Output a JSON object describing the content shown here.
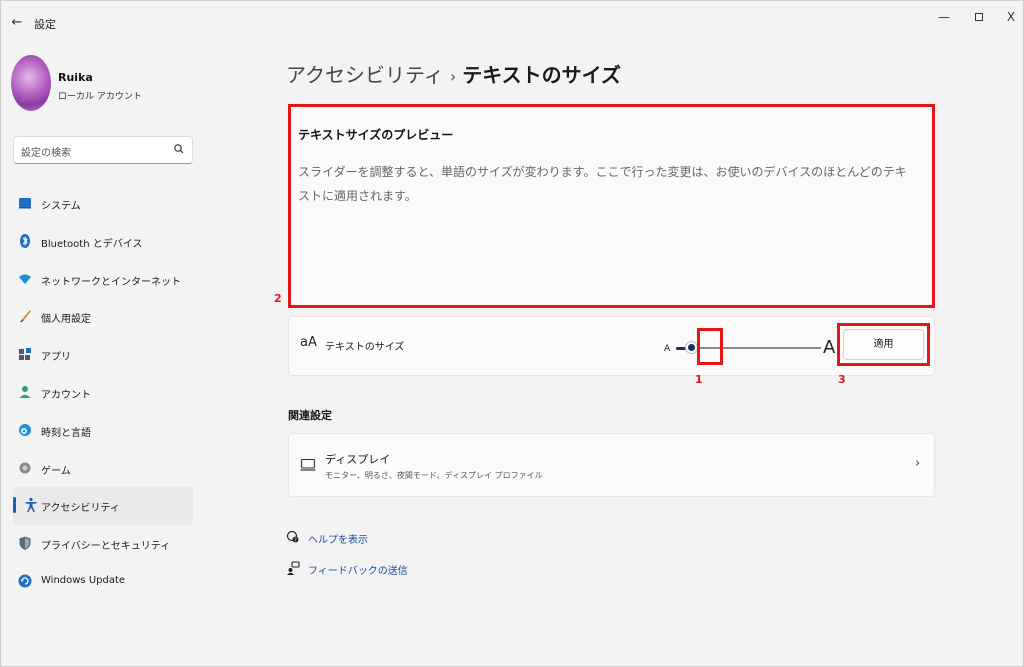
{
  "window": {
    "title": "設定",
    "back": "←",
    "minimize": "—",
    "close": "X"
  },
  "profile": {
    "name": "Ruika",
    "account_type": "ローカル アカウント"
  },
  "search": {
    "placeholder": "設定の検索"
  },
  "sidebar": {
    "items": [
      {
        "label": "システム",
        "icon": "system-icon",
        "color": "#1f6fc7"
      },
      {
        "label": "Bluetooth とデバイス",
        "icon": "bluetooth-icon",
        "color": "#1f6fc7"
      },
      {
        "label": "ネットワークとインターネット",
        "icon": "wifi-icon",
        "color": "#1f8fd8"
      },
      {
        "label": "個人用設定",
        "icon": "brush-icon",
        "color": "#d98b2a"
      },
      {
        "label": "アプリ",
        "icon": "apps-icon",
        "color": "#4a5a70"
      },
      {
        "label": "アカウント",
        "icon": "account-icon",
        "color": "#2aa37a"
      },
      {
        "label": "時刻と言語",
        "icon": "globe-icon",
        "color": "#1f8fd8"
      },
      {
        "label": "ゲーム",
        "icon": "game-icon",
        "color": "#7a7a7a"
      },
      {
        "label": "アクセシビリティ",
        "icon": "accessibility-icon",
        "color": "#1a5fb4",
        "active": true
      },
      {
        "label": "プライバシーとセキュリティ",
        "icon": "shield-icon",
        "color": "#5a6a80"
      },
      {
        "label": "Windows Update",
        "icon": "update-icon",
        "color": "#1f6fc7"
      }
    ]
  },
  "breadcrumb": {
    "parent": "アクセシビリティ",
    "separator": "›",
    "current": "テキストのサイズ"
  },
  "preview": {
    "title": "テキストサイズのプレビュー",
    "body": "スライダーを調整すると、単語のサイズが変わります。ここで行った変更は、お使いのデバイスのほとんどのテキストに適用されます。"
  },
  "annotations": {
    "slider": "1",
    "preview": "2",
    "apply": "3"
  },
  "text_size": {
    "icon": "aA",
    "label": "テキストのサイズ",
    "small_a": "A",
    "large_a": "A",
    "slider_value_fraction": 0.11,
    "apply_label": "適用"
  },
  "related": {
    "title": "関連設定",
    "display_title": "ディスプレイ",
    "display_sub": "モニター、明るさ、夜間モード、ディスプレイ プロファイル",
    "chevron": "›"
  },
  "links": {
    "help": "ヘルプを表示",
    "feedback": "フィードバックの送信"
  },
  "colors": {
    "accent": "#1a5fb4",
    "annotation": "#e01818",
    "link": "#1a4d9c"
  }
}
